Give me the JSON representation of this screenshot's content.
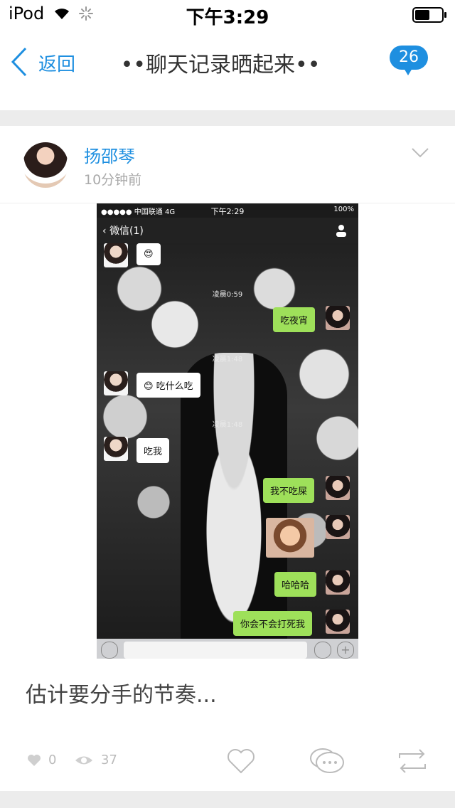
{
  "status_bar": {
    "carrier": "iPod",
    "time": "下午3:29"
  },
  "nav": {
    "back_label": "返回",
    "title": "••聊天记录晒起来••",
    "badge_count": "26",
    "accent_color": "#1e8fe0"
  },
  "post": {
    "author": "扬邵琴",
    "time_ago": "10分钟前",
    "caption": "估计要分手的节奏...",
    "likes": "0",
    "views": "37"
  },
  "screenshot": {
    "carrier": "●●●●● 中国联通  4G",
    "time": "下午2:29",
    "battery": "100%",
    "back_label": "微信(1)",
    "timestamps": [
      "凌晨0:59",
      "凌晨1:48",
      "凌晨1:48"
    ],
    "messages": [
      {
        "side": "left",
        "text": "😍"
      },
      {
        "side": "right",
        "text": "吃夜宵"
      },
      {
        "side": "left",
        "text": "😊 吃什么吃"
      },
      {
        "side": "left",
        "text": "吃我"
      },
      {
        "side": "right",
        "text": "我不吃屎"
      },
      {
        "side": "right",
        "text": "哈哈哈"
      },
      {
        "side": "right",
        "text": "你会不会打死我"
      }
    ],
    "bubble_color_left": "#ffffff",
    "bubble_color_right": "#9ee05a"
  },
  "icons": {
    "wifi": "wifi-icon",
    "loading": "activity-spinner-icon",
    "battery": "battery-icon",
    "back": "chevron-left-icon",
    "menu": "chevron-down-icon",
    "like": "heart-icon",
    "views": "eye-icon",
    "comment": "comment-icon",
    "share": "repost-icon"
  }
}
